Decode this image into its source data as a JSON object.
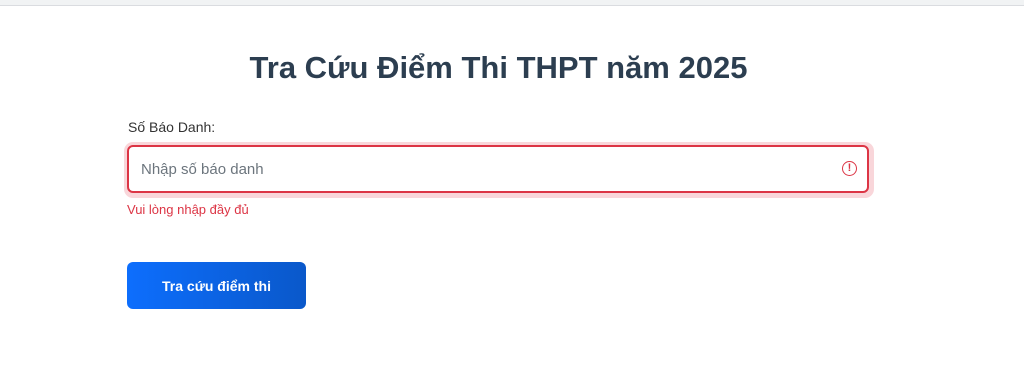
{
  "page": {
    "title": "Tra Cứu Điểm Thi THPT năm 2025"
  },
  "form": {
    "label": "Số Báo Danh:",
    "input_placeholder": "Nhập số báo danh",
    "input_value": "",
    "error_message": "Vui lòng nhập đầy đủ",
    "error_icon": "alert-circle-icon",
    "submit_label": "Tra cứu điểm thi"
  },
  "colors": {
    "title": "#2c3e50",
    "error": "#dc3545",
    "button_start": "#0d6efd",
    "button_end": "#0a58ca"
  }
}
